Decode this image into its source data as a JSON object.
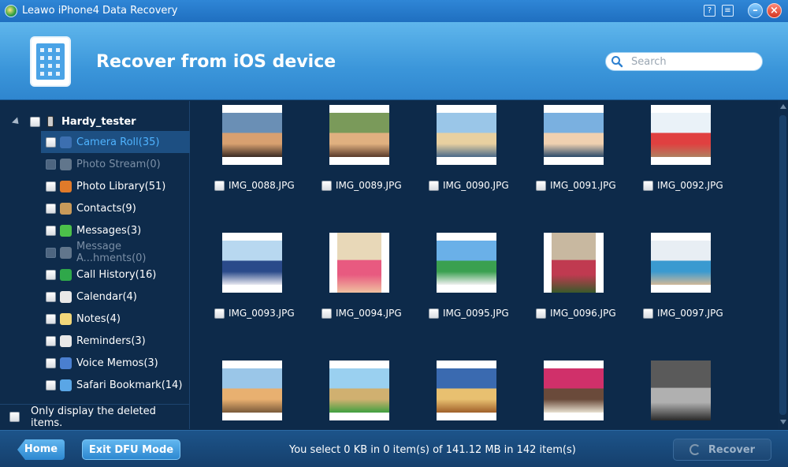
{
  "window": {
    "title": "Leawo iPhone4 Data Recovery",
    "help_glyph": "?",
    "menu_glyph": "≡",
    "minimize_glyph": "–",
    "close_glyph": "×"
  },
  "header": {
    "heading": "Recover from iOS device",
    "search_placeholder": "Search"
  },
  "sidebar": {
    "device_name": "Hardy_tester",
    "items": [
      {
        "label": "Camera Roll(35)",
        "icon": "camera-roll-icon",
        "state": "selected"
      },
      {
        "label": "Photo Stream(0)",
        "icon": "photo-stream-icon",
        "state": "disabled"
      },
      {
        "label": "Photo Library(51)",
        "icon": "photo-library-icon",
        "state": "normal"
      },
      {
        "label": "Contacts(9)",
        "icon": "contacts-icon",
        "state": "normal"
      },
      {
        "label": "Messages(3)",
        "icon": "messages-icon",
        "state": "normal"
      },
      {
        "label": "Message A...hments(0)",
        "icon": "message-attachments-icon",
        "state": "disabled"
      },
      {
        "label": "Call History(16)",
        "icon": "call-history-icon",
        "state": "normal"
      },
      {
        "label": "Calendar(4)",
        "icon": "calendar-icon",
        "state": "normal"
      },
      {
        "label": "Notes(4)",
        "icon": "notes-icon",
        "state": "normal"
      },
      {
        "label": "Reminders(3)",
        "icon": "reminders-icon",
        "state": "normal"
      },
      {
        "label": "Voice Memos(3)",
        "icon": "voice-memos-icon",
        "state": "normal"
      },
      {
        "label": "Safari Bookmark(14)",
        "icon": "safari-bookmark-icon",
        "state": "normal"
      }
    ],
    "only_deleted_label": "Only display the deleted items."
  },
  "photos": [
    {
      "name": "IMG_0088.JPG"
    },
    {
      "name": "IMG_0089.JPG"
    },
    {
      "name": "IMG_0090.JPG"
    },
    {
      "name": "IMG_0091.JPG"
    },
    {
      "name": "IMG_0092.JPG"
    },
    {
      "name": "IMG_0093.JPG"
    },
    {
      "name": "IMG_0094.JPG"
    },
    {
      "name": "IMG_0095.JPG"
    },
    {
      "name": "IMG_0096.JPG"
    },
    {
      "name": "IMG_0097.JPG"
    },
    {
      "name": ""
    },
    {
      "name": ""
    },
    {
      "name": ""
    },
    {
      "name": ""
    },
    {
      "name": ""
    }
  ],
  "footer": {
    "home_label": "Home",
    "exit_dfu_label": "Exit DFU Mode",
    "status": "You select 0 KB in 0 item(s) of 141.12 MB in 142 item(s)",
    "recover_label": "Recover"
  },
  "colors": {
    "accent": "#3b96da",
    "background": "#0d2a4a",
    "selected_text": "#4fb3ff"
  }
}
